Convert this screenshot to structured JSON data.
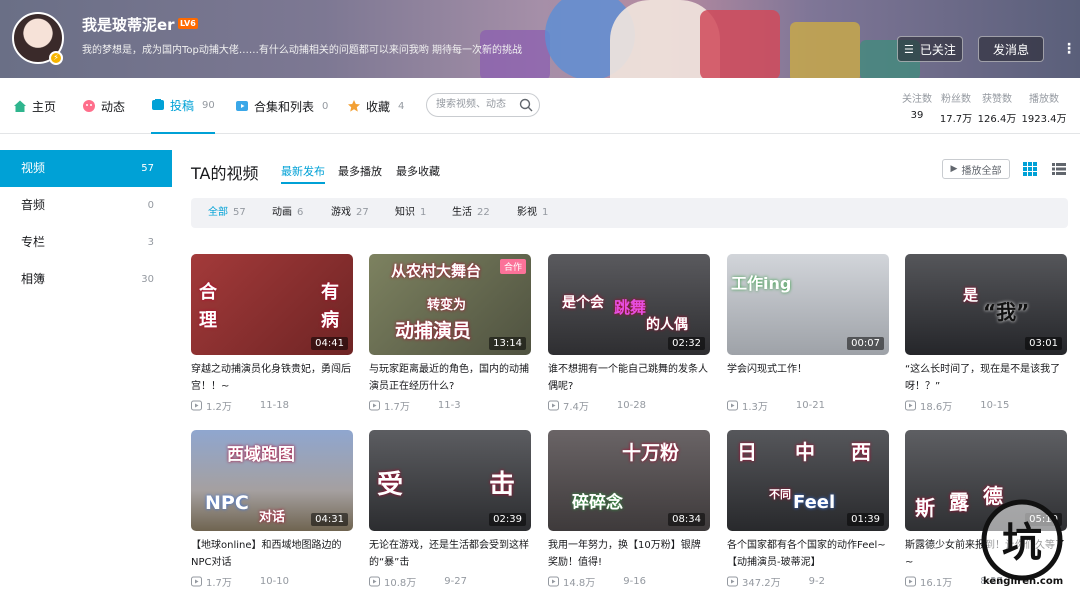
{
  "header": {
    "username": "我是玻蒂泥er",
    "level": "LV6",
    "signature": "我的梦想是，成为国内Top动捕大佬……有什么动捕相关的问题都可以来问我哟 期待每一次新的挑战",
    "follow_label": "已关注",
    "message_label": "发消息",
    "more_label": "⋮"
  },
  "nav": {
    "home": "主页",
    "dynamic": "动态",
    "contribute": "投稿",
    "contribute_count": "90",
    "collections": "合集和列表",
    "collections_count": "0",
    "favorites": "收藏",
    "favorites_count": "4",
    "search_placeholder": "搜索视频、动态"
  },
  "stats": [
    {
      "label": "关注数",
      "value": "39"
    },
    {
      "label": "粉丝数",
      "value": "17.7万"
    },
    {
      "label": "获赞数",
      "value": "126.4万"
    },
    {
      "label": "播放数",
      "value": "1923.4万"
    }
  ],
  "sidebar": [
    {
      "label": "视频",
      "count": "57"
    },
    {
      "label": "音频",
      "count": "0"
    },
    {
      "label": "专栏",
      "count": "3"
    },
    {
      "label": "相簿",
      "count": "30"
    }
  ],
  "content": {
    "title": "TA的视频",
    "sorts": [
      "最新发布",
      "最多播放",
      "最多收藏"
    ],
    "play_all": "播放全部"
  },
  "filters": [
    {
      "label": "全部",
      "count": "57"
    },
    {
      "label": "动画",
      "count": "6"
    },
    {
      "label": "游戏",
      "count": "27"
    },
    {
      "label": "知识",
      "count": "1"
    },
    {
      "label": "生活",
      "count": "22"
    },
    {
      "label": "影视",
      "count": "1"
    }
  ],
  "videos": [
    {
      "title": "穿越之动捕演员化身铁贵妃，勇闯后宫！！~",
      "plays": "1.2万",
      "date": "11-18",
      "duration": "04:41",
      "overlay": [
        "合",
        "理",
        "有",
        "病"
      ],
      "bg": "#8a2f2f"
    },
    {
      "title": "与玩家距离最近的角色，国内的动捕演员正在经历什么?",
      "plays": "1.7万",
      "date": "11-3",
      "duration": "13:14",
      "tag": "合作",
      "overlay": [
        "从农村大舞台",
        "转变为",
        "动捕演员"
      ],
      "bg": "#6b6f56"
    },
    {
      "title": "谁不想拥有一个能自己跳舞的发条人偶呢?",
      "plays": "7.4万",
      "date": "10-28",
      "duration": "02:32",
      "overlay": [
        "是个会",
        "跳舞",
        "的人偶"
      ],
      "bg": "#4a4a4d"
    },
    {
      "title": "学会闪现式工作！",
      "plays": "1.3万",
      "date": "10-21",
      "duration": "00:07",
      "overlay": [
        "工作ing"
      ],
      "bg": "#b8bcc2"
    },
    {
      "title": "“这么长时间了，现在是不是该我了呀！？”",
      "plays": "18.6万",
      "date": "10-15",
      "duration": "03:01",
      "overlay": [
        "是",
        "“我”"
      ],
      "bg": "#3a3b3f"
    },
    {
      "title": "【地球online】和西域地图路边的NPC对话",
      "plays": "1.7万",
      "date": "10-10",
      "duration": "04:31",
      "overlay": [
        "西域跑图",
        "NPC",
        "对话"
      ],
      "bg": "#7b8db0"
    },
    {
      "title": "无论在游戏，还是生活都会受到这样的“暴”击",
      "plays": "10.8万",
      "date": "9-27",
      "duration": "02:39",
      "overlay": [
        "受",
        "击"
      ],
      "bg": "#3f4044"
    },
    {
      "title": "我用一年努力，换【10万粉】银牌奖励！值得!",
      "plays": "14.8万",
      "date": "9-16",
      "duration": "08:34",
      "overlay": [
        "十万粉",
        "碎碎念"
      ],
      "bg": "#5a5556"
    },
    {
      "title": "各个国家都有各个国家的动作Feel~【动捕演员-玻蒂泥】",
      "plays": "347.2万",
      "date": "9-2",
      "duration": "01:39",
      "overlay": [
        "日",
        "中",
        "西",
        "不同",
        "Feel"
      ],
      "bg": "#3c3d41"
    },
    {
      "title": "斯露德少女前来报到！让你们久等了~",
      "plays": "16.1万",
      "date": "8-27",
      "duration": "05:10",
      "overlay": [
        "斯",
        "露",
        "德"
      ],
      "bg": "#47484c"
    }
  ],
  "watermark": {
    "text": "kengliren.com",
    "glyph": "坑"
  }
}
